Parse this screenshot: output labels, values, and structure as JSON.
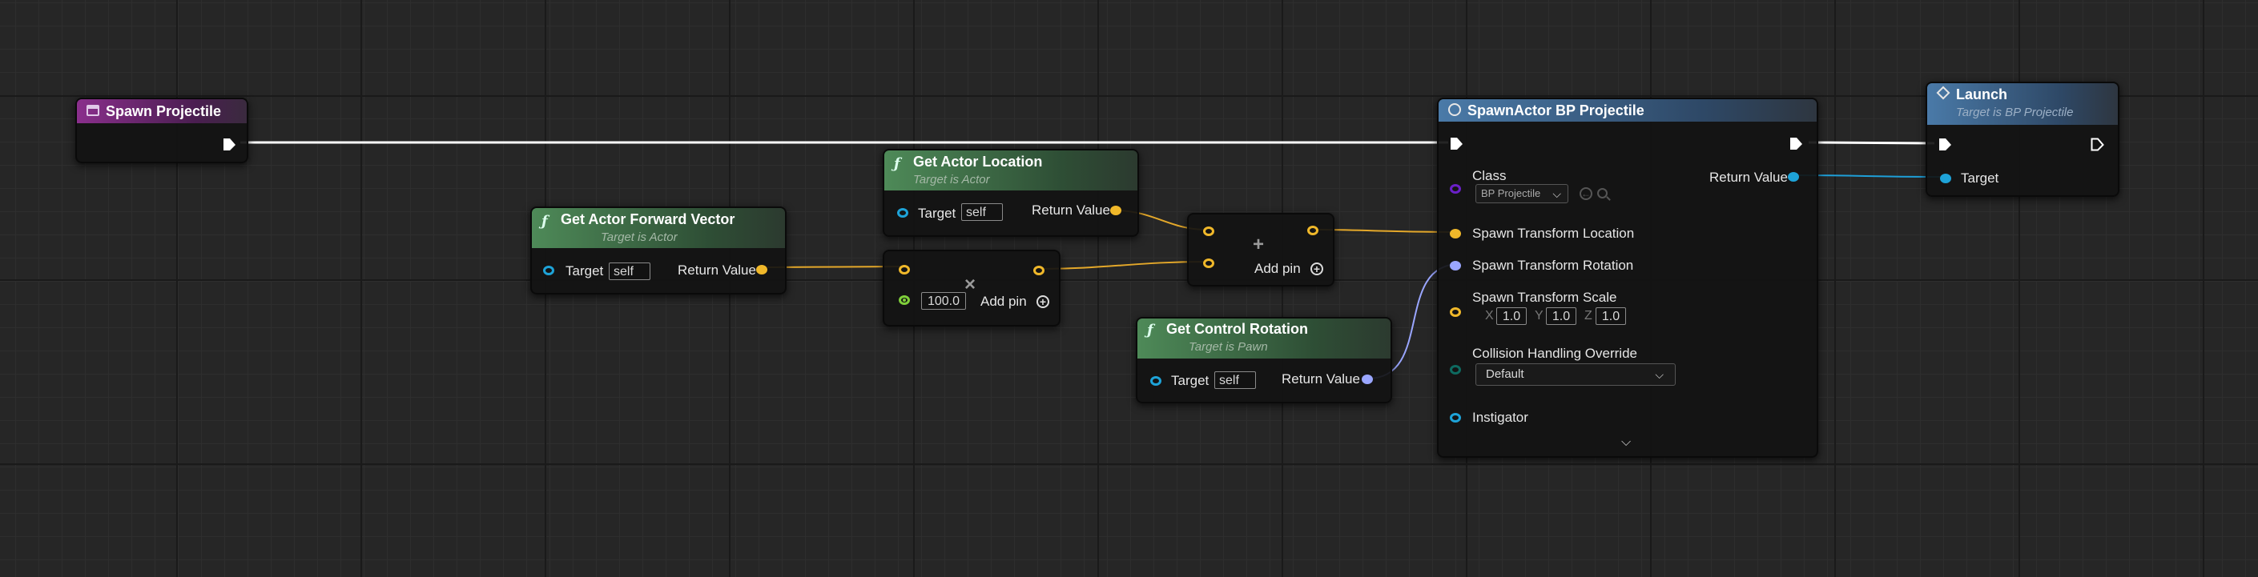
{
  "nodes": {
    "spawn_projectile": {
      "title": "Spawn Projectile",
      "icon": "event-icon",
      "color": "#8a2f8c"
    },
    "get_actor_forward_vector": {
      "title": "Get Actor Forward Vector",
      "subtitle": "Target is Actor",
      "target_label": "Target",
      "target_value": "self",
      "return_label": "Return Value",
      "icon": "function-icon"
    },
    "get_actor_location": {
      "title": "Get Actor Location",
      "subtitle": "Target is Actor",
      "target_label": "Target",
      "target_value": "self",
      "return_label": "Return Value",
      "icon": "function-icon"
    },
    "multiply": {
      "operator": "×",
      "float_value": "100.0",
      "add_pin_label": "Add pin",
      "icon": "multiply-icon"
    },
    "add": {
      "operator": "+",
      "add_pin_label": "Add pin",
      "icon": "add-icon"
    },
    "get_control_rotation": {
      "title": "Get Control Rotation",
      "subtitle": "Target is Pawn",
      "target_label": "Target",
      "target_value": "self",
      "return_label": "Return Value",
      "icon": "function-icon"
    },
    "spawn_actor": {
      "title": "SpawnActor BP Projectile",
      "class_label": "Class",
      "class_value": "BP Projectile",
      "return_label": "Return Value",
      "loc_label": "Spawn Transform Location",
      "rot_label": "Spawn Transform Rotation",
      "scale_label": "Spawn Transform Scale",
      "scale_x_label": "X",
      "scale_x": "1.0",
      "scale_y_label": "Y",
      "scale_y": "1.0",
      "scale_z_label": "Z",
      "scale_z": "1.0",
      "collision_label": "Collision Handling Override",
      "collision_value": "Default",
      "instigator_label": "Instigator",
      "icon": "spawn-actor-icon"
    },
    "launch": {
      "title": "Launch",
      "subtitle": "Target is BP Projectile",
      "target_label": "Target",
      "icon": "launch-icon"
    }
  },
  "colors": {
    "exec": "#ffffff",
    "vector": "#f0b82a",
    "rotator": "#9aa6ff",
    "object": "#1ea3d8",
    "float": "#7fcf3a",
    "class": "#6a20c8",
    "enum": "#0e6a60"
  }
}
